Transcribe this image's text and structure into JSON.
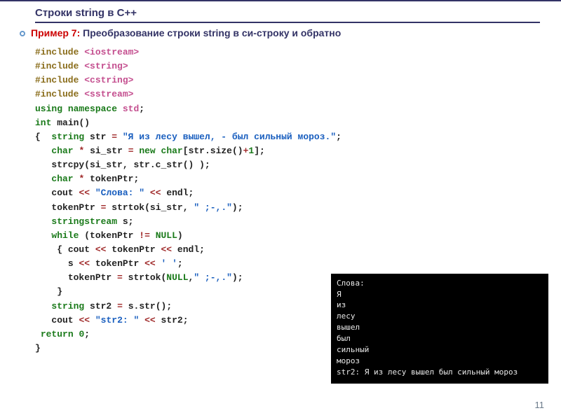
{
  "title": "Строки  string в С++",
  "example": {
    "label": "Пример 7: ",
    "text": "Преобразование строки string в си-строку и обратно"
  },
  "code": {
    "inc1": "#include ",
    "inc2": "#include ",
    "inc3": "#include ",
    "inc4": "#include ",
    "hdr1": "<iostream>",
    "hdr2": "<string>",
    "hdr3": "<cstring>",
    "hdr4": "<sstream>",
    "using": "using",
    "namespace": "namespace",
    "std": "std",
    "int": "int",
    "main": "main",
    "string": "string",
    "char": "char",
    "new": "new",
    "return": "return",
    "while": "while",
    "null": "NULL",
    "stringstream": "stringstream",
    "str": "str",
    "si_str": "si_str",
    "tokenPtr": "tokenPtr",
    "str2": "str2",
    "s": "s",
    "cout": "cout",
    "endl": "endl",
    "strcpy": "strcpy",
    "strtok": "strtok",
    "size": "size",
    "c_str": "c_str",
    "sstr": "str",
    "lit_main": "\"Я из лесу вышел, - был сильный мороз.\"",
    "lit_slova": "\"Слова: \"",
    "lit_delims": "\" ;-,.\"",
    "lit_space": "\"' '\"",
    "lit_str2": "\"str2: \"",
    "zero": "0",
    "one": "1"
  },
  "console": {
    "l1": "Слова:",
    "l2": "Я",
    "l3": "из",
    "l4": "лесу",
    "l5": "вышел",
    "l6": "был",
    "l7": "сильный",
    "l8": "мороз",
    "l9": "str2: Я из лесу вышел был сильный мороз"
  },
  "pagenum": "11"
}
